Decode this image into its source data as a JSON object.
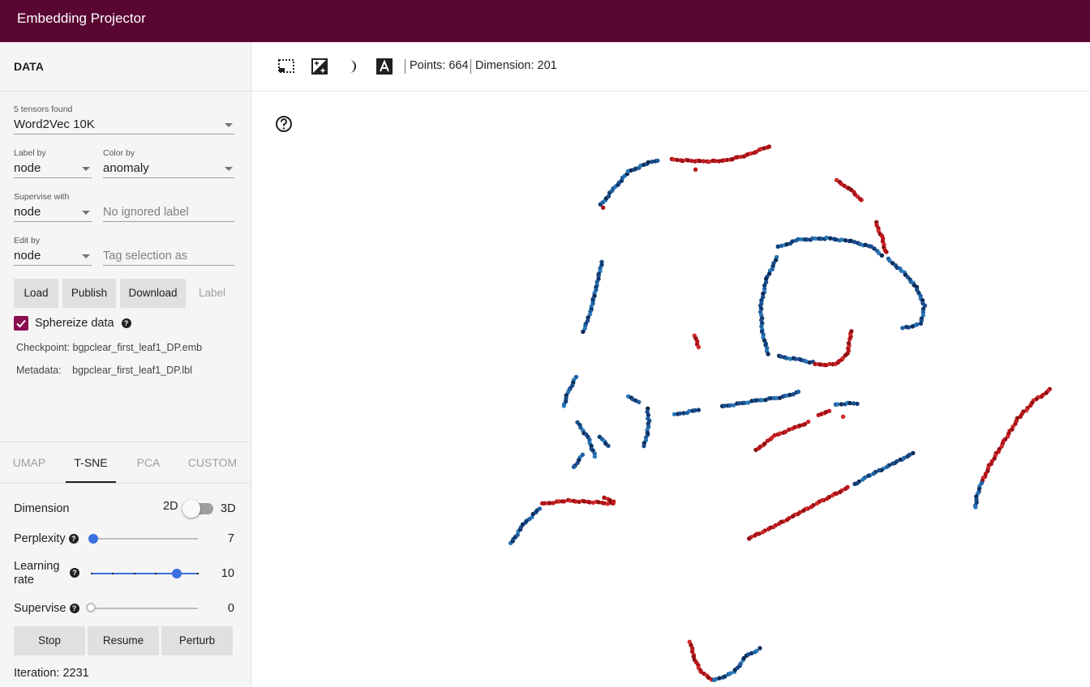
{
  "header": {
    "title": "Embedding Projector"
  },
  "data_panel": {
    "title": "DATA",
    "tensors": {
      "label": "5 tensors found",
      "value": "Word2Vec 10K"
    },
    "label_by": {
      "label": "Label by",
      "value": "node"
    },
    "color_by": {
      "label": "Color by",
      "value": "anomaly"
    },
    "supervise_with": {
      "label": "Supervise with",
      "value": "node"
    },
    "ignored_label": {
      "placeholder": "No ignored label"
    },
    "edit_by": {
      "label": "Edit by",
      "value": "node"
    },
    "tag_selection": {
      "placeholder": "Tag selection as"
    },
    "buttons": {
      "load": "Load",
      "publish": "Publish",
      "download": "Download",
      "label": "Label"
    },
    "spherize": {
      "label": "Sphereize data",
      "checked": true
    },
    "checkpoint": {
      "key": "Checkpoint:",
      "value": "bgpclear_first_leaf1_DP.emb"
    },
    "metadata": {
      "key": "Metadata:",
      "value": "bgpclear_first_leaf1_DP.lbl"
    }
  },
  "tabs": [
    {
      "label": "UMAP",
      "active": false
    },
    {
      "label": "T-SNE",
      "active": true
    },
    {
      "label": "PCA",
      "active": false
    },
    {
      "label": "CUSTOM",
      "active": false
    }
  ],
  "tsne": {
    "dimension": {
      "label": "Dimension",
      "opt2d": "2D",
      "opt3d": "3D"
    },
    "perplexity": {
      "label": "Perplexity",
      "value": "7",
      "fraction": 0.02
    },
    "learning_rate": {
      "label_line1": "Learning",
      "label_line2": "rate",
      "value": "10",
      "fraction": 0.8
    },
    "supervise": {
      "label": "Supervise",
      "value": "0",
      "fraction": 0
    },
    "buttons": {
      "stop": "Stop",
      "resume": "Resume",
      "perturb": "Perturb"
    },
    "iteration": "Iteration: 2231"
  },
  "toolbar": {
    "points": "Points: 664",
    "dimension": "Dimension: 201"
  },
  "colors": {
    "header": "#5a0632",
    "accent": "#880e4f",
    "slider": "#3b6ee0",
    "normal": "#1f5fa0",
    "anomaly": "#c0171c"
  },
  "icons": [
    "select-box-icon",
    "night-mode-contrast-icon",
    "moon-icon",
    "label-a-icon",
    "help-circle-icon"
  ]
}
